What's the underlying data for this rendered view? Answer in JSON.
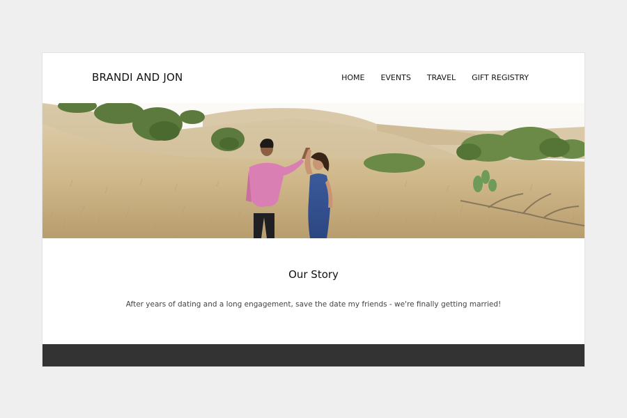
{
  "site": {
    "brand": "BRANDI AND JON",
    "nav": [
      {
        "label": "HOME"
      },
      {
        "label": "EVENTS"
      },
      {
        "label": "TRAVEL"
      },
      {
        "label": "GIFT REGISTRY"
      }
    ]
  },
  "hero": {
    "icon": "couple-in-field-photo"
  },
  "story": {
    "title": "Our Story",
    "text": "After years of dating and a long engagement, save the date my friends - we're finally getting married!"
  },
  "colors": {
    "page_bg": "#efefef",
    "card_bg": "#ffffff",
    "footer_bg": "#333333",
    "text": "#111111"
  }
}
